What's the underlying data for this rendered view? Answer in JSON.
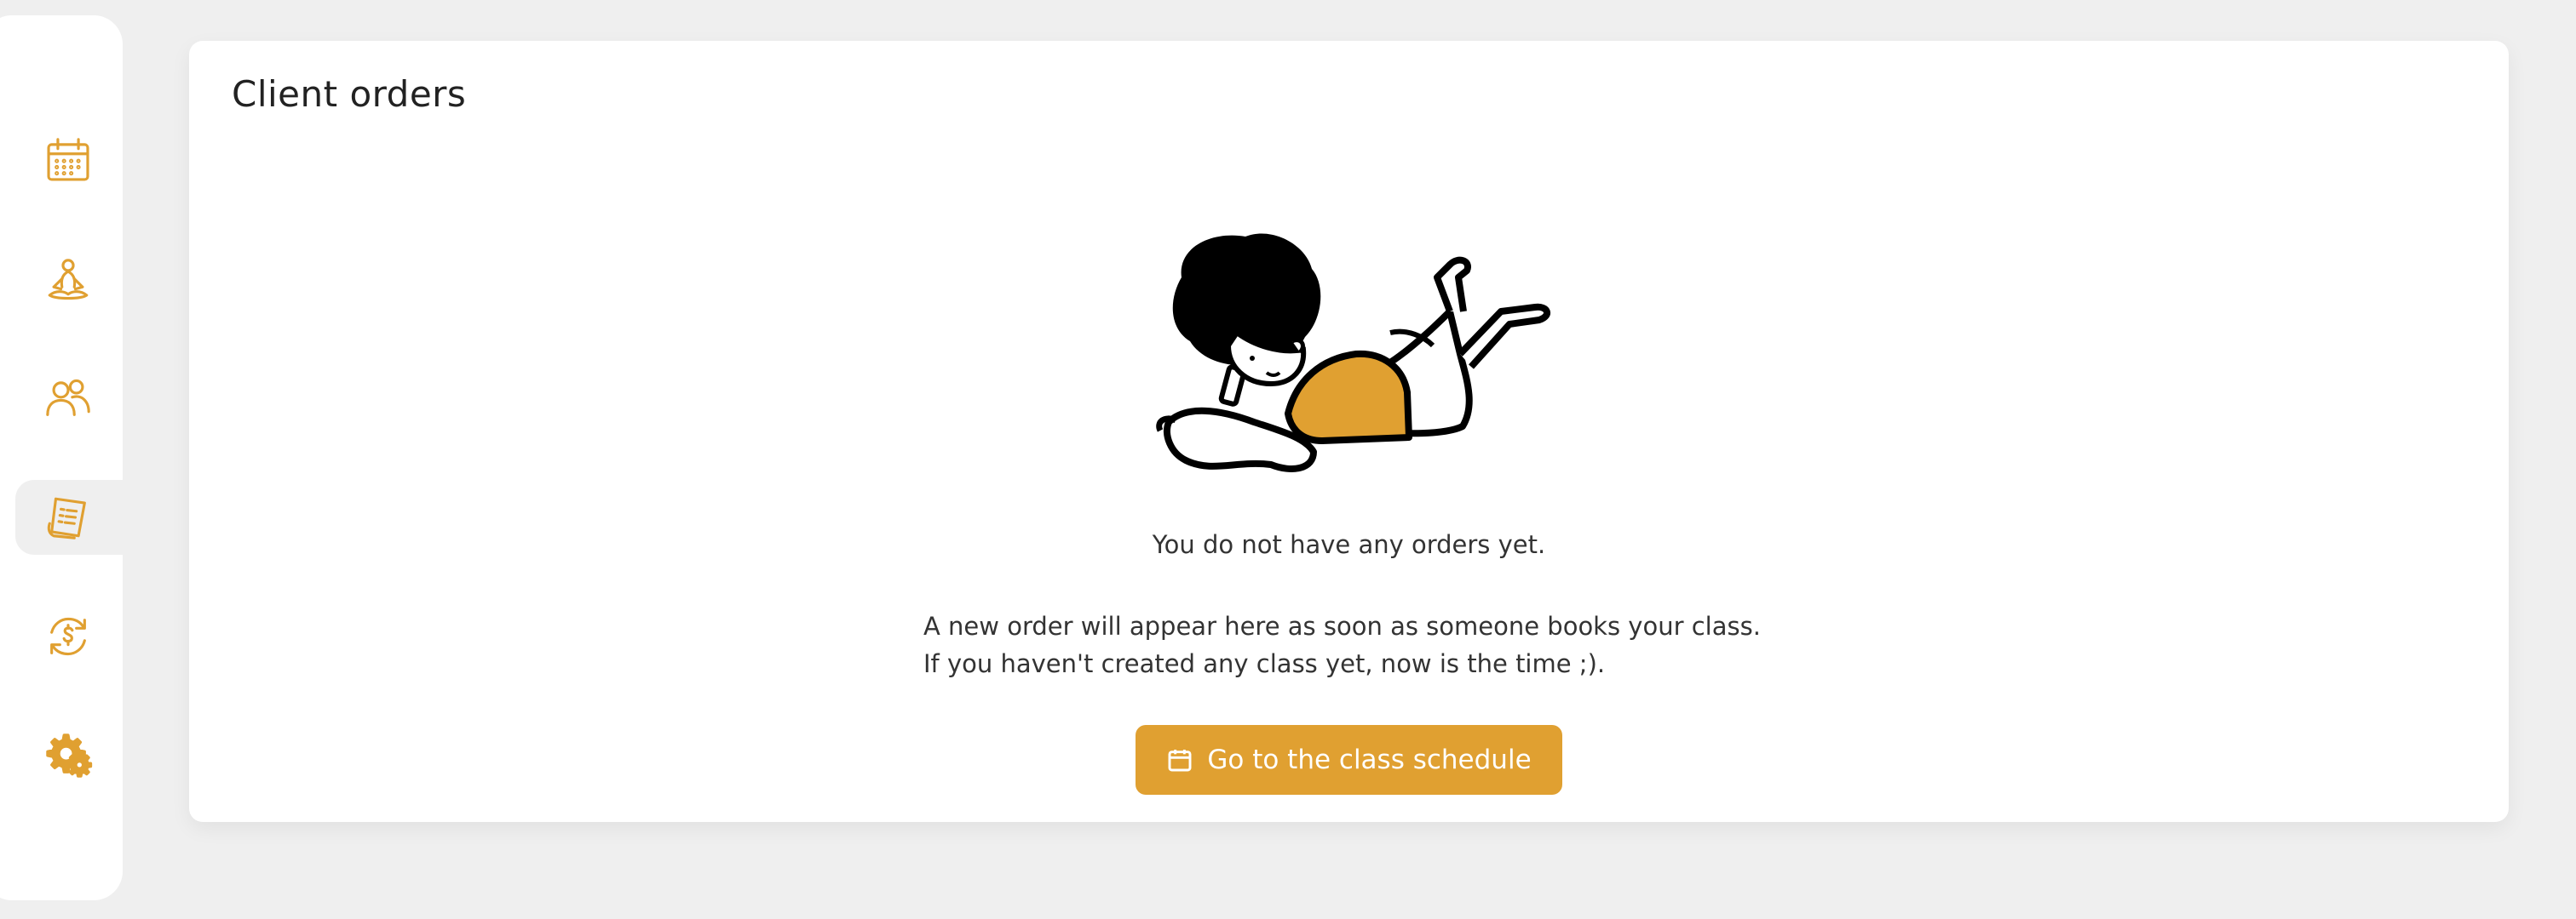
{
  "sidebar": {
    "items": [
      {
        "icon": "calendar-icon"
      },
      {
        "icon": "meditation-icon"
      },
      {
        "icon": "users-icon"
      },
      {
        "icon": "receipt-icon",
        "active": true
      },
      {
        "icon": "dollar-cycle-icon"
      },
      {
        "icon": "gears-icon"
      }
    ],
    "accent_color": "#e0a031"
  },
  "main": {
    "title": "Client orders",
    "empty_title": "You do not have any orders yet.",
    "empty_description": "A new order will appear here as soon as someone books your class. If you haven't created any class yet, now is the time ;).",
    "cta_label": "Go to the class schedule",
    "cta_icon": "calendar-icon",
    "illustration": "person-lying-with-phone"
  }
}
